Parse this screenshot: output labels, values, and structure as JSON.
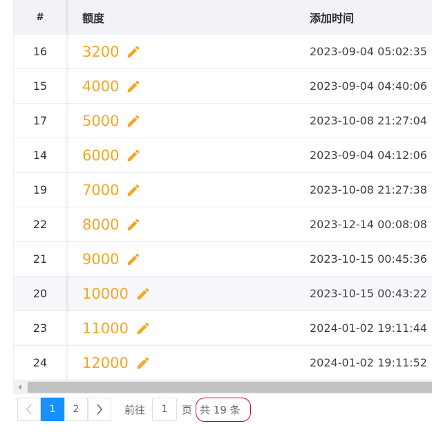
{
  "table": {
    "headers": {
      "index": "#",
      "amount": "额度",
      "time": "添加时间"
    },
    "rows": [
      {
        "id": "16",
        "amount": "3200",
        "time": "2023-09-04 05:02:35"
      },
      {
        "id": "15",
        "amount": "4000",
        "time": "2023-09-04 04:40:06"
      },
      {
        "id": "17",
        "amount": "5000",
        "time": "2023-10-08 21:27:04"
      },
      {
        "id": "14",
        "amount": "6000",
        "time": "2023-09-04 04:12:06"
      },
      {
        "id": "19",
        "amount": "7000",
        "time": "2023-10-08 21:27:38"
      },
      {
        "id": "22",
        "amount": "8000",
        "time": "2023-12-14 00:08:08"
      },
      {
        "id": "21",
        "amount": "9000",
        "time": "2023-10-15 00:45:36"
      },
      {
        "id": "20",
        "amount": "10000",
        "time": "2023-10-15 00:43:22"
      },
      {
        "id": "23",
        "amount": "11000",
        "time": "2024-01-02 19:11:44"
      },
      {
        "id": "24",
        "amount": "12000",
        "time": "2024-01-02 19:11:52"
      }
    ],
    "highlighted_row": 7,
    "edit_icon": "pencil-icon"
  },
  "pagination": {
    "prev_icon": "chevron-left-icon",
    "next_icon": "chevron-right-icon",
    "pages": [
      "1",
      "2"
    ],
    "active_page": "1",
    "goto_label": "前往",
    "goto_value": "1",
    "page_label": "页",
    "total_text": "共 19 条"
  },
  "colors": {
    "accent": "#1890ff",
    "amount": "#f5a623",
    "highlight_circle": "#d9001b"
  }
}
